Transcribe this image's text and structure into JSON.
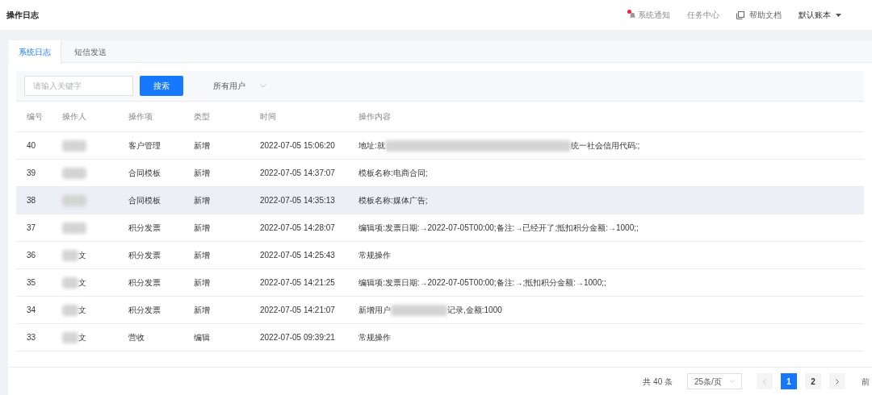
{
  "header": {
    "title": "操作日志",
    "links": [
      {
        "kind": "notify",
        "label": "系统通知",
        "unread": true
      },
      {
        "kind": "plain",
        "label": "任务中心"
      },
      {
        "kind": "doc",
        "label": "帮助文档"
      },
      {
        "kind": "account",
        "label": "默认账本"
      }
    ]
  },
  "tabs": [
    {
      "label": "系统日志",
      "selected": true
    },
    {
      "label": "短信发送",
      "selected": false
    }
  ],
  "filter": {
    "placeholder": "请输入关键字",
    "button": "搜索",
    "user_select": "所有用户"
  },
  "table": {
    "columns": [
      "编号",
      "操作人",
      "操作项",
      "类型",
      "时间",
      "操作内容"
    ],
    "rows": [
      {
        "id": "40",
        "operator": "",
        "item": "客户管理",
        "type": "新增",
        "time": "2022-07-05 15:06:20",
        "highlighted": false,
        "content": [
          {
            "kind": "text",
            "text": "地址:就"
          },
          {
            "kind": "redacted"
          },
          {
            "kind": "text",
            "text": "统一社会信用代码:;"
          }
        ]
      },
      {
        "id": "39",
        "operator": "",
        "item": "合同模板",
        "type": "新增",
        "time": "2022-07-05 14:37:07",
        "highlighted": false,
        "content": [
          {
            "kind": "text",
            "text": "模板名称:电商合同;"
          }
        ]
      },
      {
        "id": "38",
        "operator": "",
        "item": "合同模板",
        "type": "新增",
        "time": "2022-07-05 14:35:13",
        "highlighted": true,
        "content": [
          {
            "kind": "text",
            "text": "模板名称:媒体广告;"
          }
        ]
      },
      {
        "id": "37",
        "operator": "",
        "item": "积分发票",
        "type": "新增",
        "time": "2022-07-05 14:28:07",
        "highlighted": false,
        "content": [
          {
            "kind": "text",
            "text": "编辑项:发票日期:→2022-07-05T00:00;备注:→已经开了;抵扣积分金额:→1000;;"
          }
        ]
      },
      {
        "id": "36",
        "operator": "文",
        "item": "积分发票",
        "type": "新增",
        "time": "2022-07-05 14:25:43",
        "highlighted": false,
        "content": [
          {
            "kind": "text",
            "text": "常规操作"
          }
        ]
      },
      {
        "id": "35",
        "operator": "文",
        "item": "积分发票",
        "type": "新增",
        "time": "2022-07-05 14:21:25",
        "highlighted": false,
        "content": [
          {
            "kind": "text",
            "text": "编辑项:发票日期:→2022-07-05T00:00;备注:→;抵扣积分金额:→1000;;"
          }
        ]
      },
      {
        "id": "34",
        "operator": "文",
        "item": "积分发票",
        "type": "新增",
        "time": "2022-07-05 14:21:07",
        "highlighted": false,
        "content": [
          {
            "kind": "text",
            "text": "新增用户"
          },
          {
            "kind": "redacted"
          },
          {
            "kind": "text",
            "text": "记录,金额:1000"
          }
        ]
      },
      {
        "id": "33",
        "operator": "文",
        "item": "营收",
        "type": "编辑",
        "time": "2022-07-05 09:39:21",
        "highlighted": false,
        "content": [
          {
            "kind": "text",
            "text": "常规操作"
          }
        ]
      }
    ]
  },
  "pagination": {
    "total": "共 40 条",
    "page_size": "25条/页",
    "pages": [
      {
        "label": "1",
        "selected": true
      },
      {
        "label": "2",
        "selected": false
      }
    ],
    "jump": "前"
  }
}
